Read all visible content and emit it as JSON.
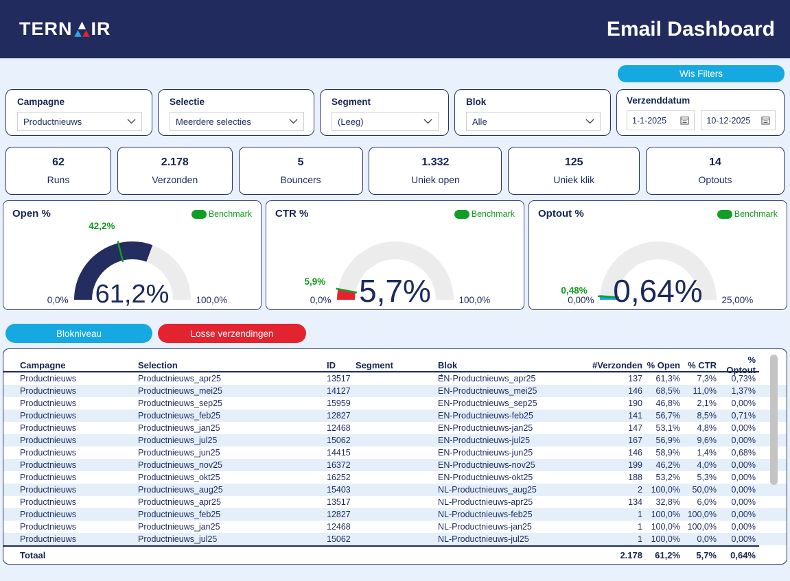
{
  "header": {
    "logo_pre": "TERN",
    "logo_post": "IR",
    "title": "Email Dashboard"
  },
  "colors": {
    "navy": "#222B5E",
    "cyan": "#16A9E1",
    "red": "#E32330",
    "green": "#129E26",
    "page_bg": "#E9F2FC",
    "alt_row": "#E4EFFA"
  },
  "icons": {
    "sort_asc": "▲",
    "logo_a_triangle": "triangle-a-blue-red",
    "chevron": "chevron-down",
    "calendar": "calendar"
  },
  "actions": {
    "clear_filters": "Wis Filters",
    "blokniveau": "Blokniveau",
    "losse_verzendingen": "Losse verzendingen"
  },
  "filters": [
    {
      "label": "Campagne",
      "value": "Productnieuws"
    },
    {
      "label": "Selectie",
      "value": "Meerdere selecties"
    },
    {
      "label": "Segment",
      "value": "(Leeg)"
    },
    {
      "label": "Blok",
      "value": "Alle"
    }
  ],
  "date_filter": {
    "label": "Verzenddatum",
    "from": "1-1-2025",
    "to": "10-12-2025"
  },
  "kpis": [
    {
      "value": "62",
      "label": "Runs"
    },
    {
      "value": "2.178",
      "label": "Verzonden"
    },
    {
      "value": "5",
      "label": "Bouncers"
    },
    {
      "value": "1.332",
      "label": "Uniek open"
    },
    {
      "value": "125",
      "label": "Uniek klik"
    },
    {
      "value": "14",
      "label": "Optouts"
    }
  ],
  "chart_data": [
    {
      "type": "gauge",
      "title": "Open %",
      "value": 61.2,
      "value_label": "61,2%",
      "min": 0,
      "max": 100,
      "min_label": "0,0%",
      "max_label": "100,0%",
      "benchmark": 42.2,
      "benchmark_label": "42,2%",
      "legend": "Benchmark",
      "fill_color": "#232D5F",
      "track_color": "#ECECEC",
      "benchmark_color": "#129E26"
    },
    {
      "type": "gauge",
      "title": "CTR %",
      "value": 5.7,
      "value_label": "5,7%",
      "min": 0,
      "max": 100,
      "min_label": "0,0%",
      "max_label": "100,0%",
      "benchmark": 5.9,
      "benchmark_label": "5,9%",
      "legend": "Benchmark",
      "fill_color": "#E32330",
      "track_color": "#ECECEC",
      "benchmark_color": "#129E26"
    },
    {
      "type": "gauge",
      "title": "Optout %",
      "value": 0.64,
      "value_label": "0,64%",
      "min": 0,
      "max": 25,
      "min_label": "0,00%",
      "max_label": "25,00%",
      "benchmark": 0.48,
      "benchmark_label": "0,48%",
      "legend": "Benchmark",
      "fill_color": "#15A7DC",
      "track_color": "#ECECEC",
      "benchmark_color": "#129E26"
    }
  ],
  "table": {
    "columns": [
      "Campagne",
      "Selection",
      "ID",
      "Segment",
      "Blok",
      "#Verzonden",
      "% Open",
      "% CTR",
      "% Optout"
    ],
    "rows": [
      [
        "Productnieuws",
        "Productnieuws_apr25",
        "13517",
        "",
        "EN-Productnieuws_apr25",
        "137",
        "61,3%",
        "7,3%",
        "0,73%"
      ],
      [
        "Productnieuws",
        "Productnieuws_mei25",
        "14127",
        "",
        "EN-Productnieuws_mei25",
        "146",
        "68,5%",
        "11,0%",
        "1,37%"
      ],
      [
        "Productnieuws",
        "Productnieuws_sep25",
        "15959",
        "",
        "EN-Productnieuws_sep25",
        "190",
        "46,8%",
        "2,1%",
        "0,00%"
      ],
      [
        "Productnieuws",
        "Productnieuws_feb25",
        "12827",
        "",
        "EN-Productnieuws-feb25",
        "141",
        "56,7%",
        "8,5%",
        "0,71%"
      ],
      [
        "Productnieuws",
        "Productnieuws_jan25",
        "12468",
        "",
        "EN-Productnieuws-jan25",
        "147",
        "53,1%",
        "4,8%",
        "0,00%"
      ],
      [
        "Productnieuws",
        "Productnieuws_jul25",
        "15062",
        "",
        "EN-Productnieuws-jul25",
        "167",
        "56,9%",
        "9,6%",
        "0,00%"
      ],
      [
        "Productnieuws",
        "Productnieuws_jun25",
        "14415",
        "",
        "EN-Productnieuws-jun25",
        "146",
        "58,9%",
        "1,4%",
        "0,68%"
      ],
      [
        "Productnieuws",
        "Productnieuws_nov25",
        "16372",
        "",
        "EN-Productnieuws-nov25",
        "199",
        "46,2%",
        "4,0%",
        "0,00%"
      ],
      [
        "Productnieuws",
        "Productnieuws_okt25",
        "16252",
        "",
        "EN-Productnieuws-okt25",
        "188",
        "53,2%",
        "5,3%",
        "0,00%"
      ],
      [
        "Productnieuws",
        "Productnieuws_aug25",
        "15403",
        "",
        "NL-Productnieuws_aug25",
        "2",
        "100,0%",
        "50,0%",
        "0,00%"
      ],
      [
        "Productnieuws",
        "Productnieuws_apr25",
        "13517",
        "",
        "NL-Productnieuws-apr25",
        "134",
        "32,8%",
        "6,0%",
        "0,00%"
      ],
      [
        "Productnieuws",
        "Productnieuws_feb25",
        "12827",
        "",
        "NL-Productnieuws-feb25",
        "1",
        "100,0%",
        "100,0%",
        "0,00%"
      ],
      [
        "Productnieuws",
        "Productnieuws_jan25",
        "12468",
        "",
        "NL-Productnieuws-jan25",
        "1",
        "100,0%",
        "100,0%",
        "0,00%"
      ],
      [
        "Productnieuws",
        "Productnieuws_jul25",
        "15062",
        "",
        "NL-Productnieuws-jul25",
        "1",
        "100,0%",
        "0,0%",
        "0,00%"
      ]
    ],
    "total": {
      "label": "Totaal",
      "verzonden": "2.178",
      "open": "61,2%",
      "ctr": "5,7%",
      "optout": "0,64%"
    }
  }
}
